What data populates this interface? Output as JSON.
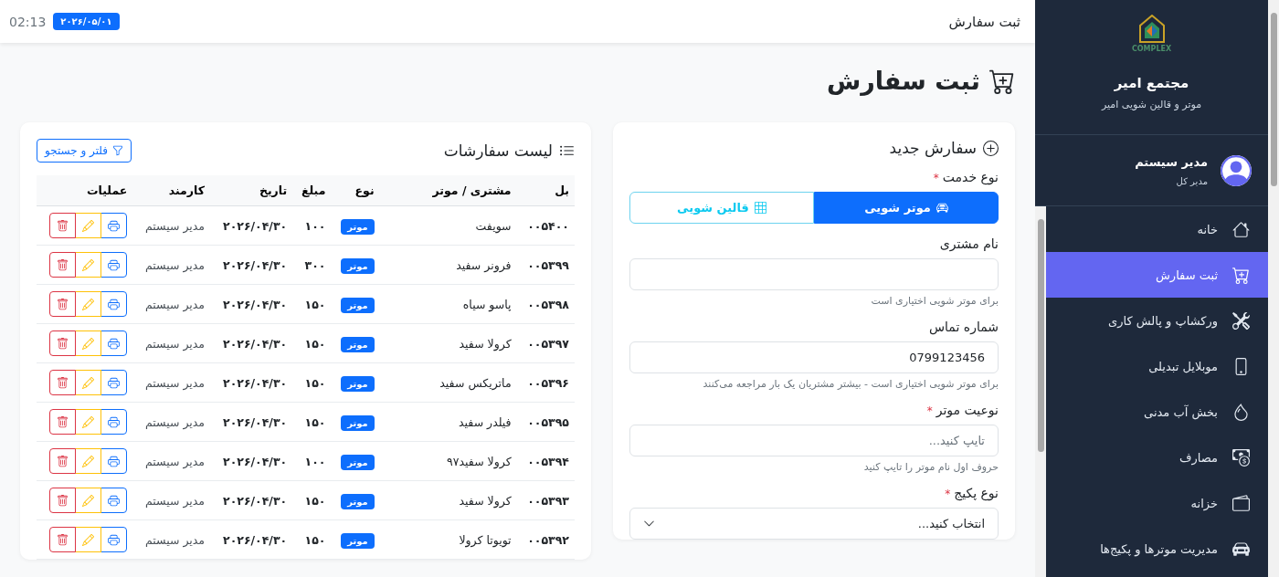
{
  "topbar": {
    "title": "ثبت سفارش",
    "date": "۲۰۲۶/۰۵/۰۱",
    "time": "02:13"
  },
  "sidebar": {
    "logo_text": "COMPLEX",
    "brand": "مجتمع امیر",
    "tagline": "موتر و قالین شویی امیر",
    "user": {
      "name": "مدیر سیستم",
      "role": "مدیر کل"
    },
    "items": [
      {
        "label": "خانه",
        "selected": false
      },
      {
        "label": "ثبت سفارش",
        "selected": true
      },
      {
        "label": "ورکشاپ و پالش کاری",
        "selected": false
      },
      {
        "label": "موبلایل تبدیلی",
        "selected": false
      },
      {
        "label": "بخش آب مدنی",
        "selected": false
      },
      {
        "label": "مصارف",
        "selected": false
      },
      {
        "label": "خزانه",
        "selected": false
      },
      {
        "label": "مدیریت موترها و پکیج‌ها",
        "selected": false
      }
    ]
  },
  "page_title": "ثبت سفارش",
  "form": {
    "title": "سفارش جدید",
    "fields": [
      {
        "kind": "segmented",
        "label": "نوع خدمت",
        "required_mark": "*",
        "options": [
          {
            "label": "موتر شویی",
            "selected": true
          },
          {
            "label": "قالین شویی",
            "selected": false
          }
        ]
      },
      {
        "kind": "text",
        "label": "نام مشتری",
        "hint": "برای موتر شویی اختیاری است"
      },
      {
        "kind": "text",
        "label": "شماره تماس",
        "value": "0799123456",
        "hint": "برای موتر شویی اختیاری است - بیشتر مشتریان یک بار مراجعه می‌کنند"
      },
      {
        "kind": "text",
        "label": "نوعیت موتر",
        "required_mark": "*",
        "placeholder": "تایپ کنید...",
        "hint": "حروف اول نام موتر را تایپ کنید"
      },
      {
        "kind": "select",
        "label": "نوع پکیج",
        "required_mark": "*",
        "value": "انتخاب کنید..."
      }
    ]
  },
  "orders": {
    "title": "لیست سفارشات",
    "filter_button": "فلتر و جستجو",
    "columns": [
      "بل",
      "مشتری / موتر",
      "نوع",
      "مبلغ",
      "تاریخ",
      "کارمند",
      "عملیات"
    ],
    "rows": [
      {
        "id": "۰۰۵۴۰۰",
        "customer": "سویفت",
        "type": "موتر",
        "amount": "۱۰۰",
        "date": "۲۰۲۶/۰۴/۳۰",
        "staff": "مدیر سیستم"
      },
      {
        "id": "۰۰۵۳۹۹",
        "customer": "فرونر سفید",
        "type": "موتر",
        "amount": "۳۰۰",
        "date": "۲۰۲۶/۰۴/۳۰",
        "staff": "مدیر سیستم"
      },
      {
        "id": "۰۰۵۳۹۸",
        "customer": "پاسو سیاه",
        "type": "موتر",
        "amount": "۱۵۰",
        "date": "۲۰۲۶/۰۴/۳۰",
        "staff": "مدیر سیستم"
      },
      {
        "id": "۰۰۵۳۹۷",
        "customer": "کرولا سفید",
        "type": "موتر",
        "amount": "۱۵۰",
        "date": "۲۰۲۶/۰۴/۳۰",
        "staff": "مدیر سیستم"
      },
      {
        "id": "۰۰۵۳۹۶",
        "customer": "ماتریکس سفید",
        "type": "موتر",
        "amount": "۱۵۰",
        "date": "۲۰۲۶/۰۴/۳۰",
        "staff": "مدیر سیستم"
      },
      {
        "id": "۰۰۵۳۹۵",
        "customer": "فیلدر سفید",
        "type": "موتر",
        "amount": "۱۵۰",
        "date": "۲۰۲۶/۰۴/۳۰",
        "staff": "مدیر سیستم"
      },
      {
        "id": "۰۰۵۳۹۴",
        "customer": "کرولا سفید۹۷",
        "type": "موتر",
        "amount": "۱۰۰",
        "date": "۲۰۲۶/۰۴/۳۰",
        "staff": "مدیر سیستم"
      },
      {
        "id": "۰۰۵۳۹۳",
        "customer": "کرولا سفید",
        "type": "موتر",
        "amount": "۱۵۰",
        "date": "۲۰۲۶/۰۴/۳۰",
        "staff": "مدیر سیستم"
      },
      {
        "id": "۰۰۵۳۹۲",
        "customer": "تویوتا کرولا",
        "type": "موتر",
        "amount": "۱۵۰",
        "date": "۲۰۲۶/۰۴/۳۰",
        "staff": "مدیر سیستم"
      }
    ]
  }
}
